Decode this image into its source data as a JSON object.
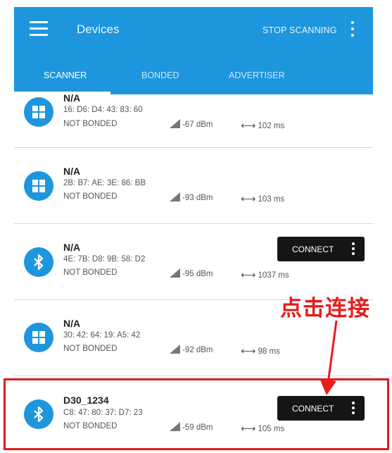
{
  "appbar": {
    "title": "Devices",
    "stop_label": "STOP SCANNING",
    "menu_icon": "hamburger-menu-icon",
    "overflow_icon": "more-vert-icon",
    "color": "#1e96de"
  },
  "tabs": [
    {
      "label": "SCANNER",
      "active": true
    },
    {
      "label": "BONDED",
      "active": false
    },
    {
      "label": "ADVERTISER",
      "active": false
    }
  ],
  "devices": [
    {
      "name": "N/A",
      "mac": "16: D6: D4: 43: 83: 60",
      "bond": "NOT BONDED",
      "rssi": "-67 dBm",
      "interval": "102 ms",
      "icon": "windows-icon",
      "connectable": false
    },
    {
      "name": "N/A",
      "mac": "2B: B7: AE: 3E: 86: BB",
      "bond": "NOT BONDED",
      "rssi": "-93 dBm",
      "interval": "103 ms",
      "icon": "windows-icon",
      "connectable": false
    },
    {
      "name": "N/A",
      "mac": "4E: 7B: D8: 9B: 58: D2",
      "bond": "NOT BONDED",
      "rssi": "-95 dBm",
      "interval": "1037 ms",
      "icon": "bluetooth-icon",
      "connectable": true
    },
    {
      "name": "N/A",
      "mac": "30: 42: 64: 19: A5: 42",
      "bond": "NOT BONDED",
      "rssi": "-92 dBm",
      "interval": "98 ms",
      "icon": "windows-icon",
      "connectable": false
    },
    {
      "name": "D30_1234",
      "mac": "C8: 47: 80: 37: D7: 23",
      "bond": "NOT BONDED",
      "rssi": "-59 dBm",
      "interval": "105 ms",
      "icon": "bluetooth-icon",
      "connectable": true
    }
  ],
  "connect_label": "CONNECT",
  "annotation": {
    "text": "点击连接",
    "color": "#e81c1c"
  }
}
